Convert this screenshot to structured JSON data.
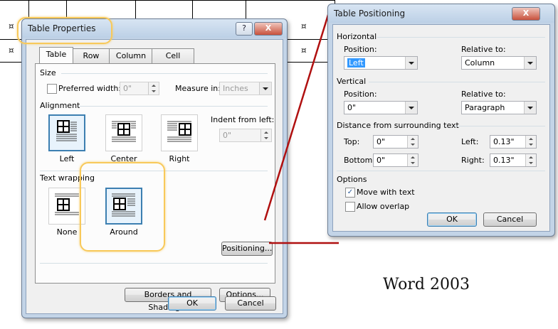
{
  "background_table": {
    "cell_mark": "¤"
  },
  "table_properties": {
    "title": "Table Properties",
    "help_btn": "?",
    "close_btn": "X",
    "tabs": [
      {
        "label": "Table",
        "active": true
      },
      {
        "label": "Row",
        "active": false
      },
      {
        "label": "Column",
        "active": false
      },
      {
        "label": "Cell",
        "active": false
      }
    ],
    "size": {
      "group_label": "Size",
      "preferred_width_label": "Preferred width:",
      "preferred_width_value": "0\"",
      "measure_in_label": "Measure in:",
      "measure_in_value": "Inches"
    },
    "alignment": {
      "group_label": "Alignment",
      "options": [
        "Left",
        "Center",
        "Right"
      ],
      "selected": "Left",
      "indent_label": "Indent from left:",
      "indent_value": "0\""
    },
    "text_wrapping": {
      "group_label": "Text wrapping",
      "options": [
        "None",
        "Around"
      ],
      "selected": "Around",
      "positioning_button": "Positioning..."
    },
    "borders_button": "Borders and Shading...",
    "options_button": "Options...",
    "ok_button": "OK",
    "cancel_button": "Cancel"
  },
  "table_positioning": {
    "title": "Table Positioning",
    "close_btn": "X",
    "horizontal": {
      "group_label": "Horizontal",
      "position_label": "Position:",
      "position_value": "Left",
      "relative_label": "Relative to:",
      "relative_value": "Column"
    },
    "vertical": {
      "group_label": "Vertical",
      "position_label": "Position:",
      "position_value": "0\"",
      "relative_label": "Relative to:",
      "relative_value": "Paragraph"
    },
    "distance": {
      "group_label": "Distance from surrounding text",
      "top_label": "Top:",
      "top_value": "0\"",
      "bottom_label": "Bottom:",
      "bottom_value": "0\"",
      "left_label": "Left:",
      "left_value": "0.13\"",
      "right_label": "Right:",
      "right_value": "0.13\""
    },
    "options": {
      "group_label": "Options",
      "move_with_text_label": "Move with text",
      "move_with_text_checked": true,
      "allow_overlap_label": "Allow overlap",
      "allow_overlap_checked": false
    },
    "ok_button": "OK",
    "cancel_button": "Cancel"
  },
  "caption": "Word 2003",
  "colors": {
    "highlight": "#f8c95a",
    "arrow_line": "#b01010",
    "selection": "#3399ff"
  }
}
